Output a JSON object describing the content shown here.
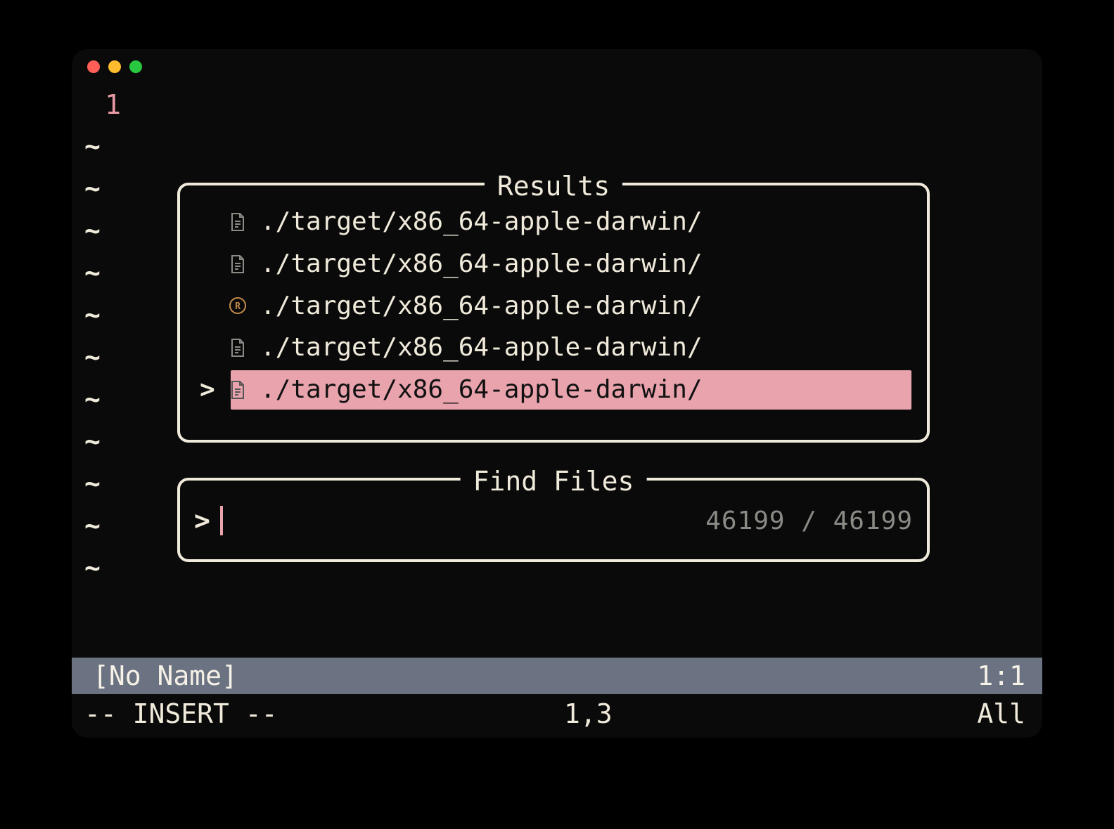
{
  "traffic_lights": {
    "red": "#ff5f57",
    "yellow": "#febc2e",
    "green": "#28c840"
  },
  "line_number": "1",
  "tilde_count": 11,
  "results": {
    "title": "Results",
    "items": [
      {
        "icon": "file",
        "path": "./target/x86_64-apple-darwin/",
        "selected": false
      },
      {
        "icon": "file",
        "path": "./target/x86_64-apple-darwin/",
        "selected": false
      },
      {
        "icon": "rust",
        "path": "./target/x86_64-apple-darwin/",
        "selected": false
      },
      {
        "icon": "file",
        "path": "./target/x86_64-apple-darwin/",
        "selected": false
      },
      {
        "icon": "file",
        "path": "./target/x86_64-apple-darwin/",
        "selected": true
      }
    ],
    "marker": ">"
  },
  "find_files": {
    "title": "Find Files",
    "prompt": ">",
    "query": "",
    "count_text": "46199 / 46199",
    "cursor_color": "#e8a3ad"
  },
  "status_bar": {
    "buffer_name": "[No Name]",
    "position": "1:1"
  },
  "mode_line": {
    "mode": "-- INSERT --",
    "cursor": "1,3",
    "scroll": "All"
  },
  "colors": {
    "fg": "#f0eadb",
    "bg": "#0a0a0a",
    "accent": "#e8a3ad",
    "status_bg": "#6b7383",
    "dim": "#8b8b86"
  }
}
